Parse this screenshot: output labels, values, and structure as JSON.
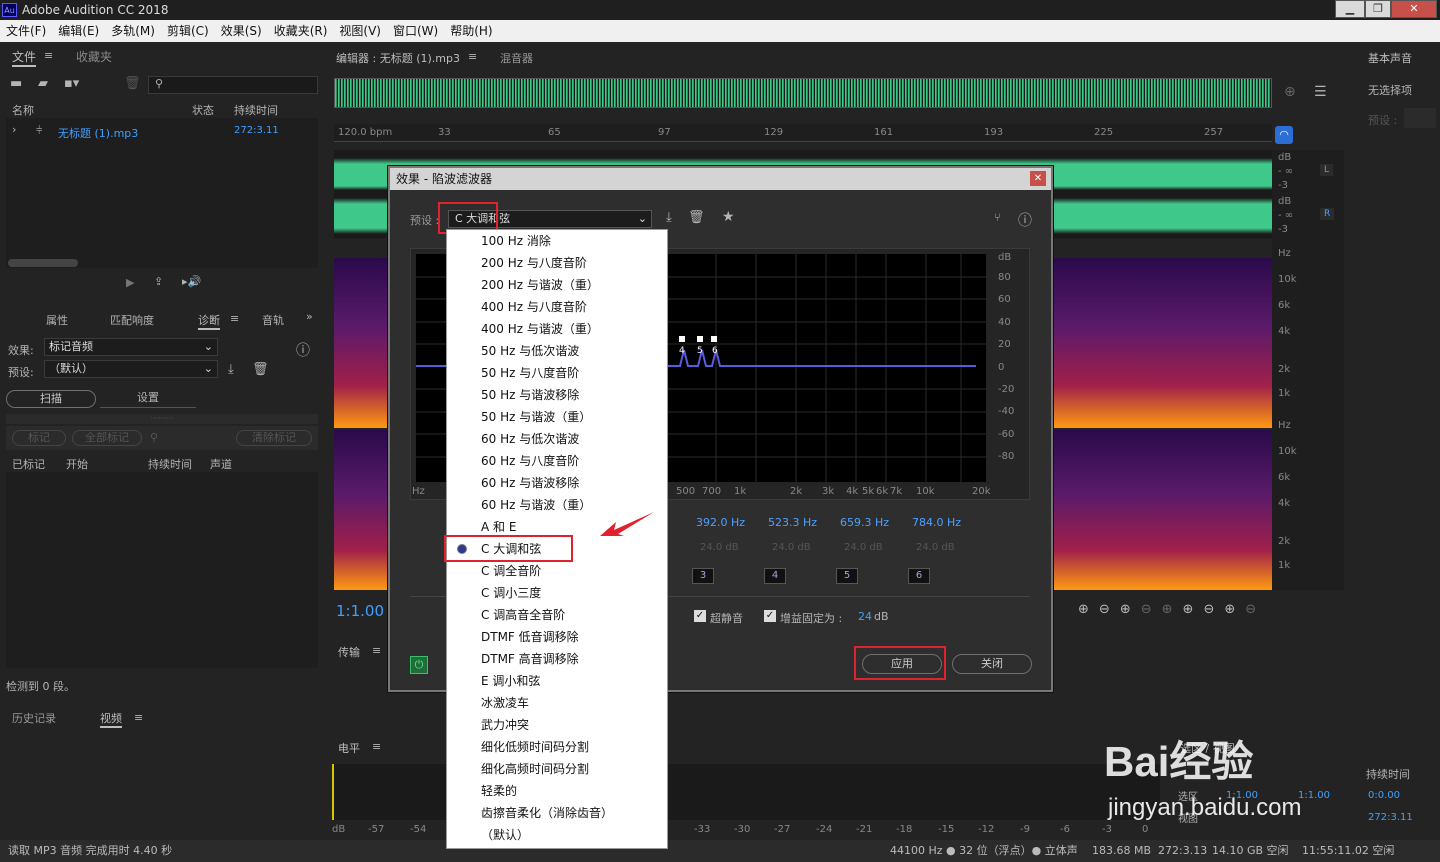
{
  "window": {
    "title": "Adobe Audition CC 2018",
    "icon_text": "Au"
  },
  "menu": [
    "文件(F)",
    "编辑(E)",
    "多轨(M)",
    "剪辑(C)",
    "效果(S)",
    "收藏夹(R)",
    "视图(V)",
    "窗口(W)",
    "帮助(H)"
  ],
  "files_panel": {
    "tab1": "文件",
    "tab2": "收藏夹",
    "col_name": "名称",
    "col_status": "状态",
    "col_duration": "持续时间",
    "file_name": "无标题 (1).mp3",
    "file_duration": "272:3.11"
  },
  "diag_panel": {
    "tabs": [
      "属性",
      "匹配响度",
      "诊断",
      "音轨"
    ],
    "effect_label": "效果:",
    "effect_value": "标记音频",
    "preset_label": "预设:",
    "preset_value": "（默认）",
    "scan": "扫描",
    "settings": "设置",
    "mark": "标记",
    "mark_all": "全部标记",
    "clear": "清除标记",
    "col_marked": "已标记",
    "col_start": "开始",
    "col_duration": "持续时间",
    "col_channel": "声道",
    "detected": "检测到 0 段。"
  },
  "history_panel": {
    "tab1": "历史记录",
    "tab2": "视频"
  },
  "editor": {
    "tab": "编辑器 : 无标题 (1).mp3",
    "mixer": "混音器",
    "bpm": "120.0 bpm",
    "ruler": [
      "33",
      "65",
      "97",
      "129",
      "161",
      "193",
      "225",
      "257"
    ],
    "zoom": "1:1.00",
    "db_labels": [
      "dB",
      "- ∞",
      "-3",
      "dB",
      "- ∞",
      "-3"
    ],
    "hz_labels": [
      "Hz",
      "10k",
      "6k",
      "4k",
      "2k",
      "1k",
      "Hz",
      "10k",
      "6k",
      "4k",
      "2k",
      "1k"
    ],
    "ch_left": "L",
    "ch_right": "R"
  },
  "right_panel": {
    "title": "基本声音",
    "none": "无选择项",
    "preset": "预设 :"
  },
  "transport": {
    "title": "传输"
  },
  "levels": {
    "title": "电平",
    "scale": [
      "dB",
      "-57",
      "-54",
      "-33",
      "-30",
      "-27",
      "-24",
      "-21",
      "-18",
      "-15",
      "-12",
      "-9",
      "-6",
      "-3",
      "0"
    ]
  },
  "selection": {
    "title": "选区 / 视图",
    "duration_hdr": "持续时间",
    "selection": "选区",
    "view": "视图",
    "sel_start": "1:1.00",
    "sel_end": "1:1.00",
    "sel_dur": "0:0.00",
    "view_dur": "272:3.11"
  },
  "dialog": {
    "title": "效果 - 陷波滤波器",
    "preset_label": "预设 :",
    "preset_value": "C 大调和弦",
    "db_axis": [
      "dB",
      "80",
      "60",
      "40",
      "20",
      "0",
      "-20",
      "-40",
      "-60",
      "-80"
    ],
    "hz_axis": [
      "Hz",
      "500",
      "700",
      "1k",
      "2k",
      "3k",
      "4k",
      "5k",
      "6k",
      "7k",
      "10k",
      "20k"
    ],
    "markers": [
      "4",
      "5",
      "6"
    ],
    "bands": [
      {
        "freq": "392.0 Hz",
        "gain": "24.0 dB",
        "num": "3"
      },
      {
        "freq": "523.3 Hz",
        "gain": "24.0 dB",
        "num": "4"
      },
      {
        "freq": "659.3 Hz",
        "gain": "24.0 dB",
        "num": "5"
      },
      {
        "freq": "784.0 Hz",
        "gain": "24.0 dB",
        "num": "6"
      }
    ],
    "ultra_quiet": "超静音",
    "gain_fixed": "增益固定为 :",
    "gain_value": "24",
    "gain_unit": "dB",
    "apply": "应用",
    "close": "关闭"
  },
  "dropdown": [
    "100 Hz 消除",
    "200 Hz 与八度音阶",
    "200 Hz 与谐波（重）",
    "400 Hz 与八度音阶",
    "400 Hz 与谐波（重）",
    "50 Hz 与低次谐波",
    "50 Hz 与八度音阶",
    "50 Hz 与谐波移除",
    "50 Hz 与谐波（重）",
    "60 Hz 与低次谐波",
    "60 Hz 与八度音阶",
    "60 Hz 与谐波移除",
    "60 Hz 与谐波（重）",
    "A 和 E",
    "C 大调和弦",
    "C 调全音阶",
    "C 调小三度",
    "C 调高音全音阶",
    "DTMF 低音调移除",
    "DTMF 高音调移除",
    "E 调小和弦",
    "冰激凌车",
    "武力冲突",
    "细化低频时间码分割",
    "细化高频时间码分割",
    "轻柔的",
    "齿擦音柔化（消除齿音）",
    "（默认）"
  ],
  "status": {
    "left": "读取 MP3 音频 完成用时 4.40 秒",
    "rate": "44100 Hz ● 32 位（浮点）● 立体声",
    "size": "183.68 MB",
    "dur": "272:3.13",
    "free": "14.10 GB 空闲",
    "time": "11:55:11.02 空闲"
  },
  "watermark": {
    "logo": "Bai经验",
    "url": "jingyan.baidu.com"
  },
  "colors": {
    "accent": "#3fa0ff",
    "wave": "#3ec98a",
    "red": "#e0212e"
  }
}
